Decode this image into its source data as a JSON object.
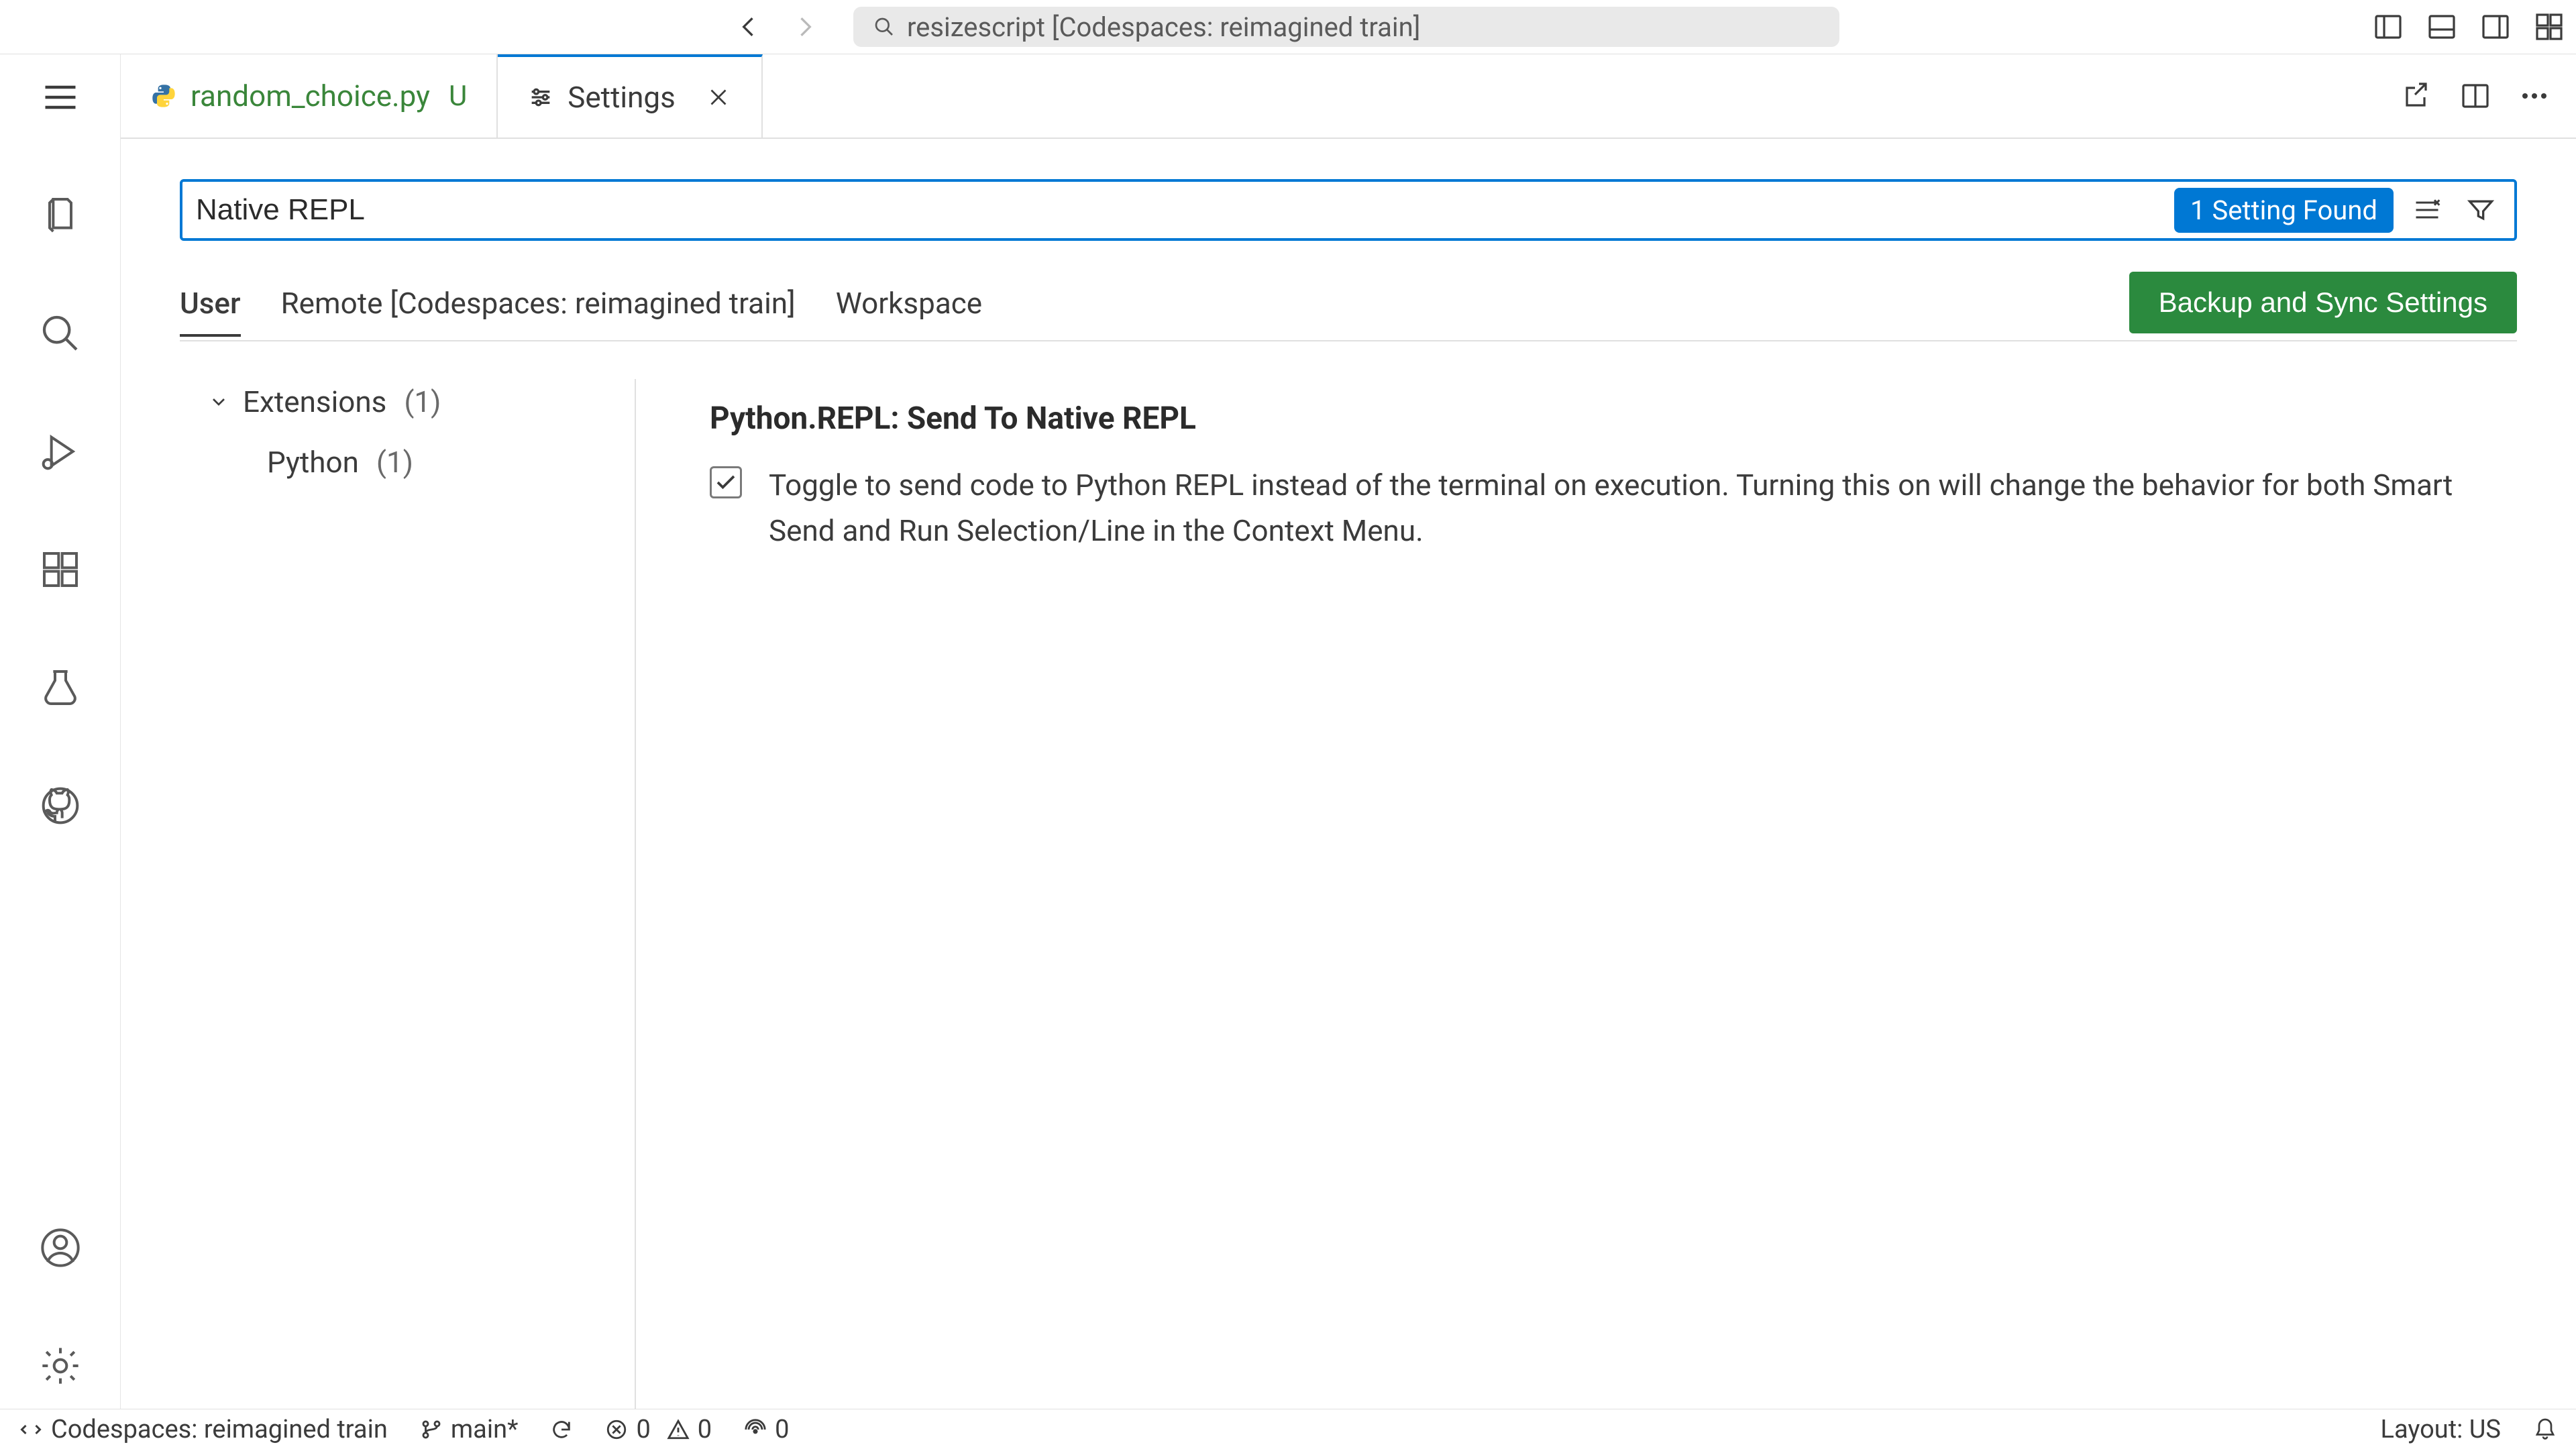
{
  "titlebar": {
    "search_text": "resizescript [Codespaces: reimagined train]"
  },
  "tabs": [
    {
      "label": "random_choice.py",
      "suffix": "U",
      "active": false
    },
    {
      "label": "Settings",
      "suffix": "",
      "active": true
    }
  ],
  "settings": {
    "search_value": "Native REPL",
    "found_label": "1 Setting Found",
    "scopes": {
      "user": "User",
      "remote": "Remote [Codespaces: reimagined train]",
      "workspace": "Workspace"
    },
    "sync_button": "Backup and Sync Settings",
    "toc": {
      "ext_label": "Extensions",
      "ext_count": "(1)",
      "python_label": "Python",
      "python_count": "(1)"
    },
    "item": {
      "title": "Python.REPL: Send To Native REPL",
      "description": "Toggle to send code to Python REPL instead of the terminal on execution. Turning this on will change the behavior for both Smart Send and Run Selection/Line in the Context Menu."
    }
  },
  "statusbar": {
    "remote": "Codespaces: reimagined train",
    "branch": "main*",
    "errors": "0",
    "warnings": "0",
    "ports": "0",
    "layout": "Layout: US"
  }
}
